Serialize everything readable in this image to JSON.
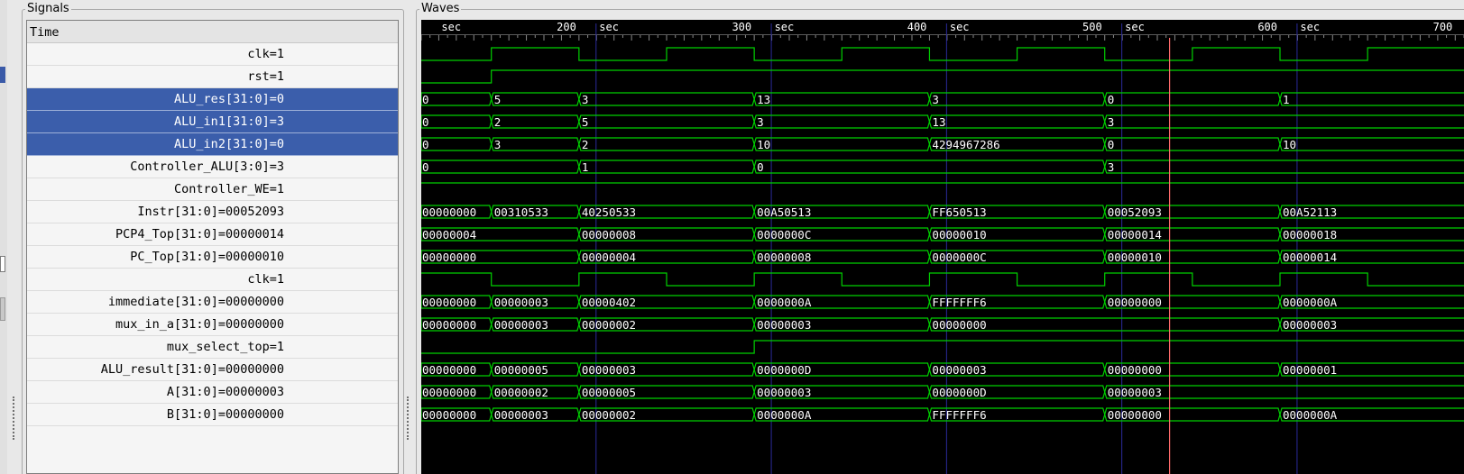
{
  "panels": {
    "signals_title": "Signals",
    "waves_title": "Waves"
  },
  "signals": {
    "header": "Time",
    "rows": [
      {
        "name": "clk",
        "value": "1",
        "selected": false
      },
      {
        "name": "rst",
        "value": "1",
        "selected": false
      },
      {
        "name": "ALU_res[31:0]",
        "value": "0",
        "selected": true
      },
      {
        "name": "ALU_in1[31:0]",
        "value": "3",
        "selected": true
      },
      {
        "name": "ALU_in2[31:0]",
        "value": "0",
        "selected": true
      },
      {
        "name": "Controller_ALU[3:0]",
        "value": "3",
        "selected": false
      },
      {
        "name": "Controller_WE",
        "value": "1",
        "selected": false
      },
      {
        "name": "Instr[31:0]",
        "value": "00052093",
        "selected": false
      },
      {
        "name": "PCP4_Top[31:0]",
        "value": "00000014",
        "selected": false
      },
      {
        "name": "PC_Top[31:0]",
        "value": "00000010",
        "selected": false
      },
      {
        "name": "clk",
        "value": "1",
        "selected": false
      },
      {
        "name": "immediate[31:0]",
        "value": "00000000",
        "selected": false
      },
      {
        "name": "mux_in_a[31:0]",
        "value": "00000000",
        "selected": false
      },
      {
        "name": "mux_select_top",
        "value": "1",
        "selected": false
      },
      {
        "name": "ALU_result[31:0]",
        "value": "00000000",
        "selected": false
      },
      {
        "name": "A[31:0]",
        "value": "00000003",
        "selected": false
      },
      {
        "name": "B[31:0]",
        "value": "00000000",
        "selected": false
      }
    ]
  },
  "waves": {
    "time_unit": "sec",
    "view_start": 110,
    "view_end": 705,
    "cursor_time": 537,
    "ticks": [
      {
        "t": 120,
        "label": "sec"
      },
      {
        "t": 200,
        "label": "200"
      },
      {
        "t": 210,
        "label": "sec"
      },
      {
        "t": 300,
        "label": "300"
      },
      {
        "t": 310,
        "label": "sec"
      },
      {
        "t": 400,
        "label": "400"
      },
      {
        "t": 410,
        "label": "sec"
      },
      {
        "t": 500,
        "label": "500"
      },
      {
        "t": 510,
        "label": "sec"
      },
      {
        "t": 600,
        "label": "600"
      },
      {
        "t": 610,
        "label": "sec"
      },
      {
        "t": 700,
        "label": "700"
      }
    ],
    "major_ticks": [
      210,
      310,
      410,
      510,
      610
    ],
    "rows": [
      {
        "kind": "bit",
        "initial": 0,
        "transitions": [
          {
            "t": 150,
            "v": 1
          },
          {
            "t": 200,
            "v": 0
          },
          {
            "t": 250,
            "v": 1
          },
          {
            "t": 300,
            "v": 0
          },
          {
            "t": 350,
            "v": 1
          },
          {
            "t": 400,
            "v": 0
          },
          {
            "t": 450,
            "v": 1
          },
          {
            "t": 500,
            "v": 0
          },
          {
            "t": 550,
            "v": 1
          },
          {
            "t": 600,
            "v": 0
          },
          {
            "t": 650,
            "v": 1
          }
        ]
      },
      {
        "kind": "bit",
        "initial": 0,
        "transitions": [
          {
            "t": 150,
            "v": 1
          }
        ]
      },
      {
        "kind": "bus",
        "segments": [
          {
            "t": 110,
            "label": "0"
          },
          {
            "t": 150,
            "label": "5"
          },
          {
            "t": 200,
            "label": "3"
          },
          {
            "t": 300,
            "label": "13"
          },
          {
            "t": 400,
            "label": "3"
          },
          {
            "t": 500,
            "label": "0"
          },
          {
            "t": 600,
            "label": "1"
          }
        ]
      },
      {
        "kind": "bus",
        "segments": [
          {
            "t": 110,
            "label": "0"
          },
          {
            "t": 150,
            "label": "2"
          },
          {
            "t": 200,
            "label": "5"
          },
          {
            "t": 300,
            "label": "3"
          },
          {
            "t": 400,
            "label": "13"
          },
          {
            "t": 500,
            "label": "3"
          }
        ]
      },
      {
        "kind": "bus",
        "segments": [
          {
            "t": 110,
            "label": "0"
          },
          {
            "t": 150,
            "label": "3"
          },
          {
            "t": 200,
            "label": "2"
          },
          {
            "t": 300,
            "label": "10"
          },
          {
            "t": 400,
            "label": "4294967286"
          },
          {
            "t": 500,
            "label": "0"
          },
          {
            "t": 600,
            "label": "10"
          }
        ]
      },
      {
        "kind": "bus",
        "segments": [
          {
            "t": 110,
            "label": "0"
          },
          {
            "t": 200,
            "label": "1"
          },
          {
            "t": 300,
            "label": "0"
          },
          {
            "t": 500,
            "label": "3"
          }
        ]
      },
      {
        "kind": "bit",
        "initial": 1,
        "transitions": []
      },
      {
        "kind": "bus",
        "segments": [
          {
            "t": 110,
            "label": "00000000"
          },
          {
            "t": 150,
            "label": "00310533"
          },
          {
            "t": 200,
            "label": "40250533"
          },
          {
            "t": 300,
            "label": "00A50513"
          },
          {
            "t": 400,
            "label": "FF650513"
          },
          {
            "t": 500,
            "label": "00052093"
          },
          {
            "t": 600,
            "label": "00A52113"
          }
        ]
      },
      {
        "kind": "bus",
        "segments": [
          {
            "t": 110,
            "label": "00000004"
          },
          {
            "t": 200,
            "label": "00000008"
          },
          {
            "t": 300,
            "label": "0000000C"
          },
          {
            "t": 400,
            "label": "00000010"
          },
          {
            "t": 500,
            "label": "00000014"
          },
          {
            "t": 600,
            "label": "00000018"
          }
        ]
      },
      {
        "kind": "bus",
        "segments": [
          {
            "t": 110,
            "label": "00000000"
          },
          {
            "t": 200,
            "label": "00000004"
          },
          {
            "t": 300,
            "label": "00000008"
          },
          {
            "t": 400,
            "label": "0000000C"
          },
          {
            "t": 500,
            "label": "00000010"
          },
          {
            "t": 600,
            "label": "00000014"
          }
        ]
      },
      {
        "kind": "bit",
        "initial": 1,
        "transitions": [
          {
            "t": 150,
            "v": 0
          },
          {
            "t": 200,
            "v": 1
          },
          {
            "t": 250,
            "v": 0
          },
          {
            "t": 300,
            "v": 1
          },
          {
            "t": 350,
            "v": 0
          },
          {
            "t": 400,
            "v": 1
          },
          {
            "t": 450,
            "v": 0
          },
          {
            "t": 500,
            "v": 1
          },
          {
            "t": 550,
            "v": 0
          },
          {
            "t": 600,
            "v": 1
          },
          {
            "t": 650,
            "v": 0
          }
        ]
      },
      {
        "kind": "bus",
        "segments": [
          {
            "t": 110,
            "label": "00000000"
          },
          {
            "t": 150,
            "label": "00000003"
          },
          {
            "t": 200,
            "label": "00000402"
          },
          {
            "t": 300,
            "label": "0000000A"
          },
          {
            "t": 400,
            "label": "FFFFFFF6"
          },
          {
            "t": 500,
            "label": "00000000"
          },
          {
            "t": 600,
            "label": "0000000A"
          }
        ]
      },
      {
        "kind": "bus",
        "segments": [
          {
            "t": 110,
            "label": "00000000"
          },
          {
            "t": 150,
            "label": "00000003"
          },
          {
            "t": 200,
            "label": "00000002"
          },
          {
            "t": 300,
            "label": "00000003"
          },
          {
            "t": 400,
            "label": "00000000"
          },
          {
            "t": 600,
            "label": "00000003"
          }
        ]
      },
      {
        "kind": "bit",
        "initial": 0,
        "transitions": [
          {
            "t": 300,
            "v": 1
          }
        ]
      },
      {
        "kind": "bus",
        "segments": [
          {
            "t": 110,
            "label": "00000000"
          },
          {
            "t": 150,
            "label": "00000005"
          },
          {
            "t": 200,
            "label": "00000003"
          },
          {
            "t": 300,
            "label": "0000000D"
          },
          {
            "t": 400,
            "label": "00000003"
          },
          {
            "t": 500,
            "label": "00000000"
          },
          {
            "t": 600,
            "label": "00000001"
          }
        ]
      },
      {
        "kind": "bus",
        "segments": [
          {
            "t": 110,
            "label": "00000000"
          },
          {
            "t": 150,
            "label": "00000002"
          },
          {
            "t": 200,
            "label": "00000005"
          },
          {
            "t": 300,
            "label": "00000003"
          },
          {
            "t": 400,
            "label": "0000000D"
          },
          {
            "t": 500,
            "label": "00000003"
          }
        ]
      },
      {
        "kind": "bus",
        "segments": [
          {
            "t": 110,
            "label": "00000000"
          },
          {
            "t": 150,
            "label": "00000003"
          },
          {
            "t": 200,
            "label": "00000002"
          },
          {
            "t": 300,
            "label": "0000000A"
          },
          {
            "t": 400,
            "label": "FFFFFFF6"
          },
          {
            "t": 500,
            "label": "00000000"
          },
          {
            "t": 600,
            "label": "0000000A"
          }
        ]
      }
    ]
  },
  "colors": {
    "wave": "#00d000",
    "grid": "#2a2a9a",
    "cursor": "#ff6a6a",
    "selection": "#3b5eab"
  }
}
